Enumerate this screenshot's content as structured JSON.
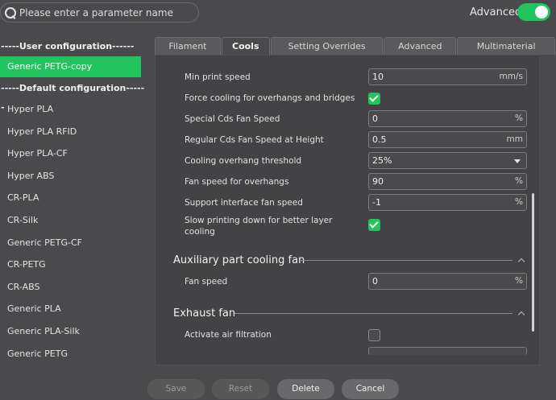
{
  "search": {
    "placeholder": "Please enter a parameter name"
  },
  "advanced": {
    "label": "Advanced",
    "enabled": true
  },
  "sidebar": {
    "user_header": "-----User configuration------",
    "user_items": [
      {
        "label": "Generic PETG-copy",
        "selected": true
      }
    ],
    "default_header": "-----Default configuration------",
    "default_items": [
      {
        "label": "Hyper PLA"
      },
      {
        "label": "Hyper PLA RFID"
      },
      {
        "label": "Hyper PLA-CF"
      },
      {
        "label": "Hyper ABS"
      },
      {
        "label": "CR-PLA"
      },
      {
        "label": "CR-Silk"
      },
      {
        "label": "Generic PETG-CF"
      },
      {
        "label": "CR-PETG"
      },
      {
        "label": "CR-ABS"
      },
      {
        "label": "Generic PLA"
      },
      {
        "label": "Generic PLA-Silk"
      },
      {
        "label": "Generic PETG"
      }
    ]
  },
  "tabs": [
    {
      "label": "Filament"
    },
    {
      "label": "Cools",
      "active": true
    },
    {
      "label": "Setting Overrides"
    },
    {
      "label": "Advanced"
    },
    {
      "label": "Multimaterial"
    }
  ],
  "settings": {
    "min_print_speed": {
      "label": "Min print speed",
      "value": "10",
      "unit": "mm/s"
    },
    "force_cooling": {
      "label": "Force cooling for overhangs and bridges",
      "checked": true
    },
    "special_cds_fan": {
      "label": "Special Cds Fan Speed",
      "value": "0",
      "unit": "%"
    },
    "regular_cds_fan": {
      "label": "Regular Cds Fan Speed at Height",
      "value": "0.5",
      "unit": "mm"
    },
    "cooling_overhang_threshold": {
      "label": "Cooling overhang threshold",
      "value": "25%"
    },
    "fan_speed_overhangs": {
      "label": "Fan speed for overhangs",
      "value": "90",
      "unit": "%"
    },
    "support_interface_fan": {
      "label": "Support interface fan speed",
      "value": "-1",
      "unit": "%"
    },
    "slow_printing": {
      "label_line1": "Slow printing down for better layer",
      "label_line2": "cooling",
      "checked": true
    }
  },
  "aux_section": {
    "title": "Auxiliary part cooling fan",
    "fan_speed": {
      "label": "Fan speed",
      "value": "0",
      "unit": "%"
    }
  },
  "exhaust_section": {
    "title": "Exhaust fan",
    "air_filtration": {
      "label": "Activate air filtration",
      "checked": false
    }
  },
  "buttons": {
    "save": "Save",
    "reset": "Reset",
    "delete": "Delete",
    "cancel": "Cancel"
  },
  "colors": {
    "accent": "#21c45d",
    "background": "#4a4a4c"
  }
}
